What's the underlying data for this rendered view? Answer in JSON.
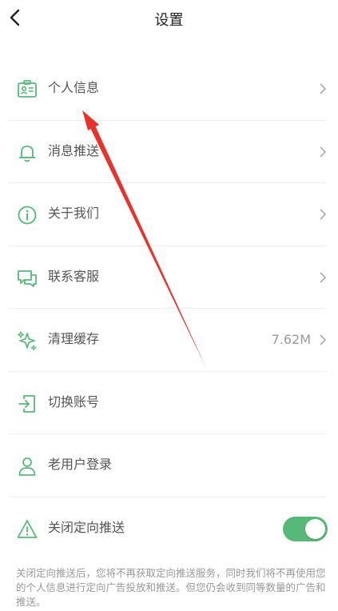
{
  "header": {
    "title": "设置",
    "back_icon": "chevron-left-icon"
  },
  "menu": {
    "items": [
      {
        "label": "个人信息",
        "icon": "id-card-icon",
        "has_chevron": true
      },
      {
        "label": "消息推送",
        "icon": "bell-icon",
        "has_chevron": true
      },
      {
        "label": "关于我们",
        "icon": "info-icon",
        "has_chevron": true
      },
      {
        "label": "联系客服",
        "icon": "chat-icon",
        "has_chevron": true
      },
      {
        "label": "清理缓存",
        "icon": "sparkle-icon",
        "value": "7.62M",
        "has_chevron": true
      },
      {
        "label": "切换账号",
        "icon": "switch-account-icon",
        "has_chevron": false
      },
      {
        "label": "老用户登录",
        "icon": "user-icon",
        "has_chevron": false
      },
      {
        "label": "关闭定向推送",
        "icon": "warning-triangle-icon",
        "toggle_on": true
      }
    ]
  },
  "note": "关闭定向推送后，您将不再获取定向推送服务，同时我们将不再使用您的个人信息进行定向广告投放和推送。但您仍会收到同等数量的广告和推送。",
  "colors": {
    "accent": "#57b979",
    "annotation_arrow": "#e8322b"
  }
}
